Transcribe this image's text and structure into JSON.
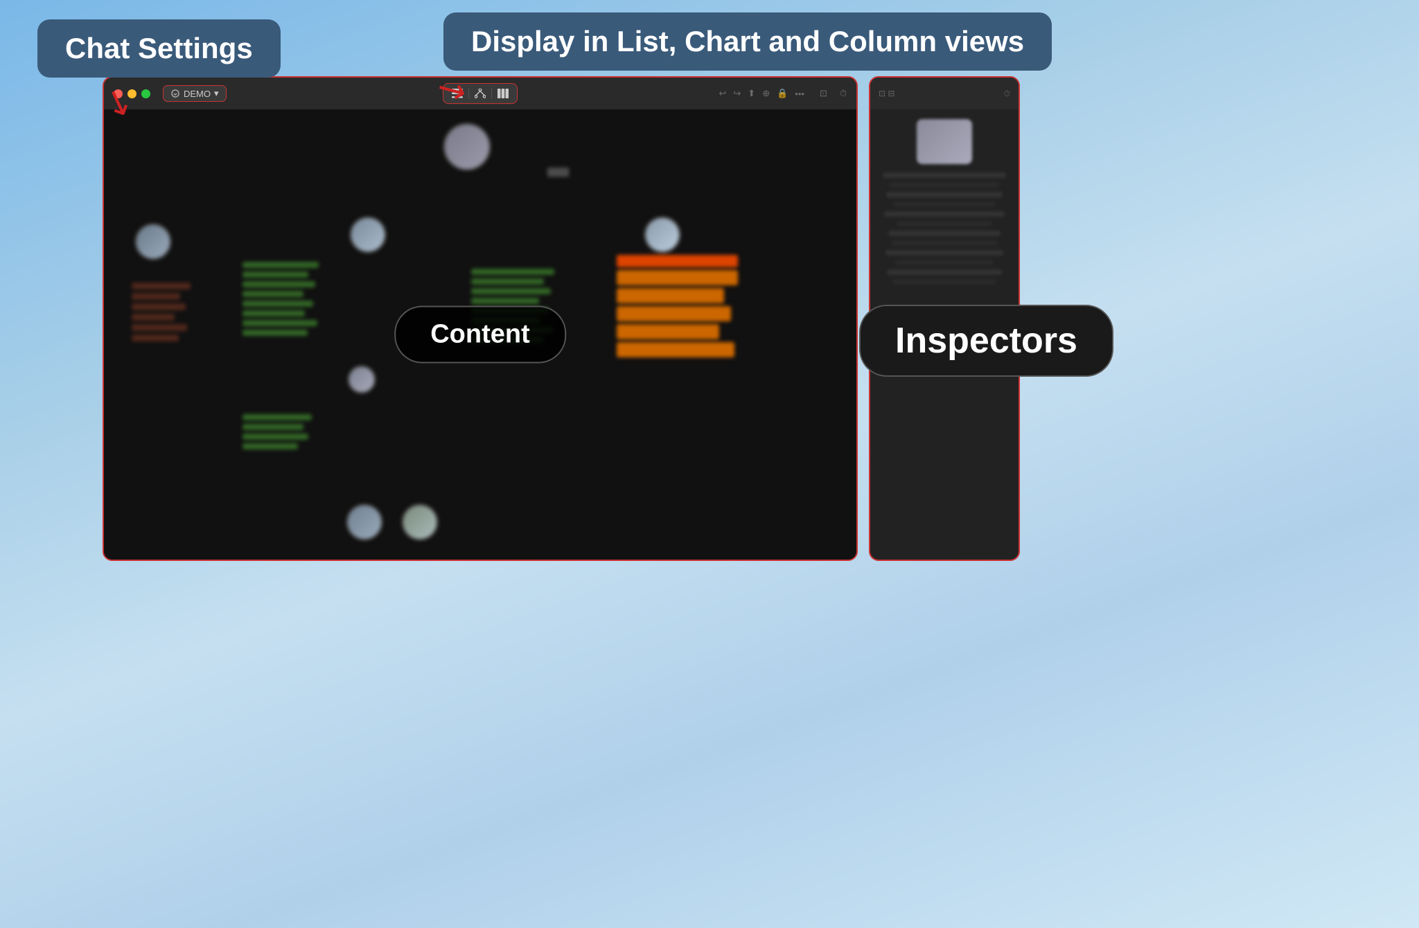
{
  "tooltips": {
    "chat_settings": "Chat Settings",
    "display_views": "Display in List, Chart and Column views"
  },
  "app": {
    "title": "DEMO",
    "title_chevron": "▾",
    "window_controls": {
      "close": "close",
      "minimize": "minimize",
      "maximize": "maximize"
    }
  },
  "toolbar": {
    "center": {
      "list_icon": "☰",
      "chart_icon": "⊞",
      "column_icon": "⊟"
    },
    "right": {
      "undo": "↩",
      "redo": "↪",
      "share": "⬆",
      "settings": "⊕",
      "lock": "🔒",
      "more": "•••",
      "sidebar": "⊡",
      "clock": "⏱"
    }
  },
  "content": {
    "label": "Content"
  },
  "inspectors": {
    "label": "Inspectors"
  },
  "colors": {
    "accent_red": "#cc3333",
    "tooltip_bg": "#3a5a7a",
    "green_bar": "#3a7a2a",
    "orange_bar": "#cc6600",
    "brown_bar": "#6a3020"
  }
}
